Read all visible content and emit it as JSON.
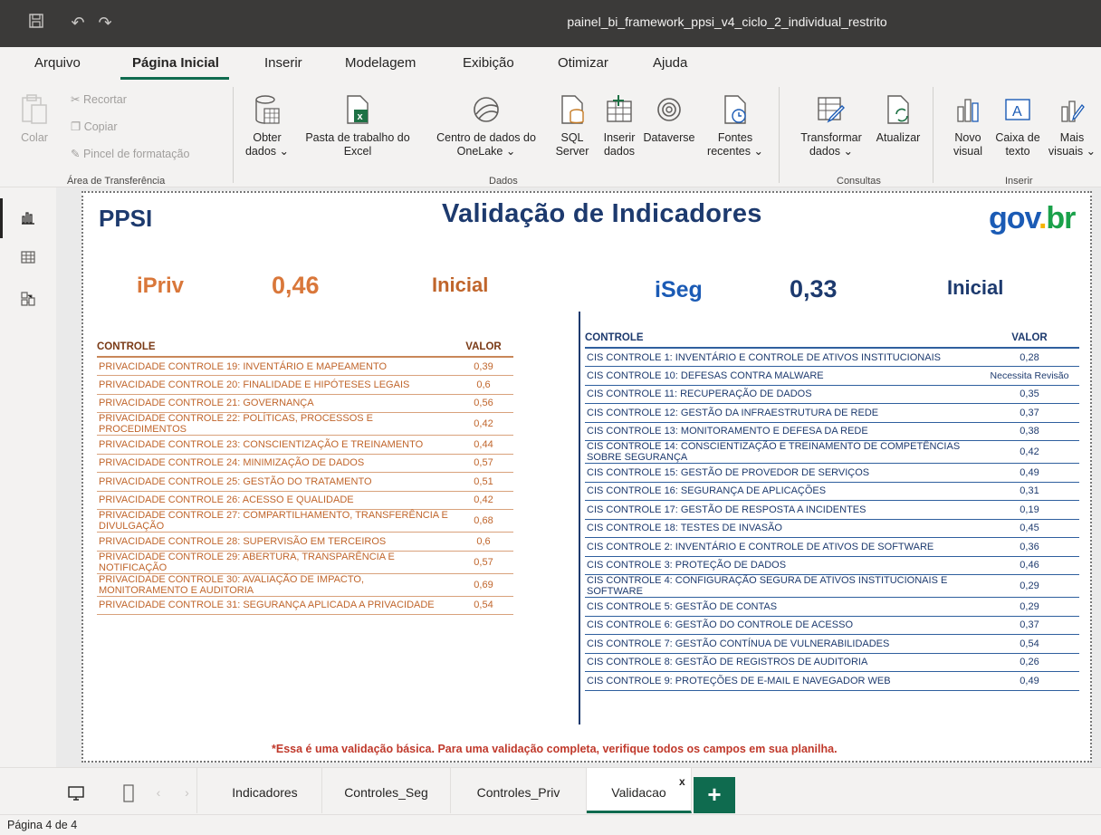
{
  "window": {
    "title": "painel_bi_framework_ppsi_v4_ciclo_2_individual_restrito"
  },
  "menu": [
    {
      "label": "Arquivo",
      "active": false
    },
    {
      "label": "Página Inicial",
      "active": true
    },
    {
      "label": "Inserir",
      "active": false
    },
    {
      "label": "Modelagem",
      "active": false
    },
    {
      "label": "Exibição",
      "active": false
    },
    {
      "label": "Otimizar",
      "active": false
    },
    {
      "label": "Ajuda",
      "active": false
    }
  ],
  "ribbon": {
    "clipboard": {
      "paste": "Colar",
      "cut": "Recortar",
      "copy": "Copiar",
      "format_painter": "Pincel de formatação",
      "group": "Área de Transferência"
    },
    "data": {
      "get_data_1": "Obter",
      "get_data_2": "dados ⌄",
      "excel_1": "Pasta de trabalho do",
      "excel_2": "Excel",
      "onelake_1": "Centro de dados do",
      "onelake_2": "OneLake ⌄",
      "sql_1": "SQL",
      "sql_2": "Server",
      "insert_1": "Inserir",
      "insert_2": "dados",
      "dataverse": "Dataverse",
      "recent_1": "Fontes",
      "recent_2": "recentes ⌄",
      "group": "Dados"
    },
    "queries": {
      "transform_1": "Transformar",
      "transform_2": "dados ⌄",
      "refresh": "Atualizar",
      "group": "Consultas"
    },
    "insert": {
      "visual_1": "Novo",
      "visual_2": "visual",
      "textbox_1": "Caixa de",
      "textbox_2": "texto",
      "more_1": "Mais",
      "more_2": "visuais ⌄",
      "group": "Inserir"
    }
  },
  "report": {
    "brand": "PPSI",
    "heading": "Validação de Indicadores",
    "logo": {
      "g1": "gov",
      "g2": ".",
      "g3": "br"
    },
    "ipriv": {
      "label": "iPriv",
      "value": "0,46",
      "level": "Inicial"
    },
    "iseg": {
      "label": "iSeg",
      "value": "0,33",
      "level": "Inicial"
    },
    "priv_table": {
      "col_control": "CONTROLE",
      "col_value": "VALOR",
      "rows": [
        {
          "c": "PRIVACIDADE CONTROLE 19: INVENTÁRIO E MAPEAMENTO",
          "v": "0,39"
        },
        {
          "c": "PRIVACIDADE CONTROLE 20: FINALIDADE E HIPÓTESES LEGAIS",
          "v": "0,6"
        },
        {
          "c": "PRIVACIDADE CONTROLE 21: GOVERNANÇA",
          "v": "0,56"
        },
        {
          "c": "PRIVACIDADE CONTROLE 22: POLÍTICAS, PROCESSOS E PROCEDIMENTOS",
          "v": "0,42"
        },
        {
          "c": "PRIVACIDADE CONTROLE 23: CONSCIENTIZAÇÃO E TREINAMENTO",
          "v": "0,44"
        },
        {
          "c": "PRIVACIDADE CONTROLE 24: MINIMIZAÇÃO DE DADOS",
          "v": "0,57"
        },
        {
          "c": "PRIVACIDADE CONTROLE 25: GESTÃO DO TRATAMENTO",
          "v": "0,51"
        },
        {
          "c": "PRIVACIDADE CONTROLE 26: ACESSO E QUALIDADE",
          "v": "0,42"
        },
        {
          "c": "PRIVACIDADE CONTROLE 27: COMPARTILHAMENTO, TRANSFERÊNCIA E DIVULGAÇÃO",
          "v": "0,68"
        },
        {
          "c": "PRIVACIDADE CONTROLE 28: SUPERVISÃO EM TERCEIROS",
          "v": "0,6"
        },
        {
          "c": "PRIVACIDADE CONTROLE 29: ABERTURA, TRANSPARÊNCIA E NOTIFICAÇÃO",
          "v": "0,57"
        },
        {
          "c": "PRIVACIDADE CONTROLE 30: AVALIAÇÃO DE IMPACTO, MONITORAMENTO E AUDITORIA",
          "v": "0,69"
        },
        {
          "c": "PRIVACIDADE CONTROLE 31: SEGURANÇA APLICADA A PRIVACIDADE",
          "v": "0,54"
        }
      ]
    },
    "seg_table": {
      "col_control": "CONTROLE",
      "col_value": "VALOR",
      "rows": [
        {
          "c": "CIS CONTROLE 1: INVENTÁRIO E CONTROLE DE ATIVOS INSTITUCIONAIS",
          "v": "0,28"
        },
        {
          "c": "CIS CONTROLE 10: DEFESAS CONTRA MALWARE",
          "v": "Necessita Revisão"
        },
        {
          "c": "CIS CONTROLE 11: RECUPERAÇÃO DE DADOS",
          "v": "0,35"
        },
        {
          "c": "CIS CONTROLE 12: GESTÃO DA INFRAESTRUTURA DE REDE",
          "v": "0,37"
        },
        {
          "c": "CIS CONTROLE 13: MONITORAMENTO E DEFESA DA REDE",
          "v": "0,38"
        },
        {
          "c": "CIS CONTROLE 14: CONSCIENTIZAÇÃO E TREINAMENTO DE COMPETÊNCIAS SOBRE SEGURANÇA",
          "v": "0,42"
        },
        {
          "c": "CIS CONTROLE 15: GESTÃO DE PROVEDOR DE SERVIÇOS",
          "v": "0,49"
        },
        {
          "c": "CIS CONTROLE 16: SEGURANÇA DE APLICAÇÕES",
          "v": "0,31"
        },
        {
          "c": "CIS CONTROLE 17: GESTÃO DE RESPOSTA A INCIDENTES",
          "v": "0,19"
        },
        {
          "c": "CIS CONTROLE 18: TESTES DE INVASÃO",
          "v": "0,45"
        },
        {
          "c": "CIS CONTROLE 2: INVENTÁRIO E CONTROLE DE ATIVOS DE SOFTWARE",
          "v": "0,36"
        },
        {
          "c": "CIS CONTROLE 3: PROTEÇÃO DE DADOS",
          "v": "0,46"
        },
        {
          "c": "CIS CONTROLE 4: CONFIGURAÇÃO SEGURA DE ATIVOS INSTITUCIONAIS E SOFTWARE",
          "v": "0,29"
        },
        {
          "c": "CIS CONTROLE 5: GESTÃO DE CONTAS",
          "v": "0,29"
        },
        {
          "c": "CIS CONTROLE 6: GESTÃO DO CONTROLE DE ACESSO",
          "v": "0,37"
        },
        {
          "c": "CIS CONTROLE 7: GESTÃO CONTÍNUA DE VULNERABILIDADES",
          "v": "0,54"
        },
        {
          "c": "CIS CONTROLE 8: GESTÃO DE REGISTROS DE AUDITORIA",
          "v": "0,26"
        },
        {
          "c": "CIS CONTROLE 9: PROTEÇÕES DE E-MAIL E NAVEGADOR WEB",
          "v": "0,49"
        }
      ]
    },
    "note": "*Essa é uma validação básica. Para uma validação completa, verifique todos os campos em sua planilha."
  },
  "pages": [
    {
      "label": "Indicadores",
      "active": false
    },
    {
      "label": "Controles_Seg",
      "active": false
    },
    {
      "label": "Controles_Priv",
      "active": false
    },
    {
      "label": "Validacao",
      "active": true
    }
  ],
  "add_page": "+",
  "close_tab": "x",
  "status": "Página 4 de 4",
  "colors": {
    "accent": "#0f6b4f",
    "navy": "#1d3a6e",
    "orange": "#c0652b",
    "red": "#c0392b"
  }
}
